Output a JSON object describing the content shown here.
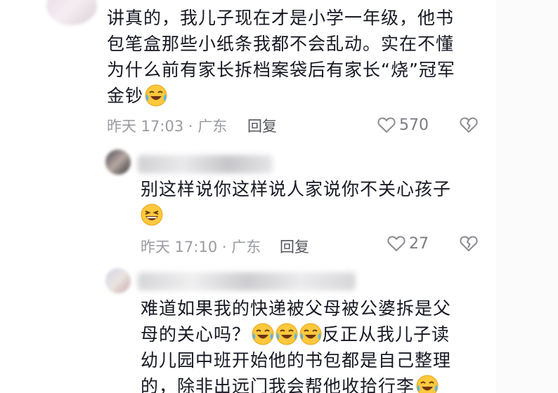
{
  "comments": [
    {
      "lines": [
        "讲真的，我儿子现在才是小学一年级，他书",
        "包笔盒那些小纸条我都不会乱动。实在不懂",
        "为什么前有家长拆档案袋后有家长“烧”冠军",
        "金钞"
      ],
      "time_location": "昨天 17:03 · 广东",
      "reply_label": "回复",
      "like_count": "570"
    },
    {
      "lines": [
        "别这样说你这样说人家说你不关心孩子"
      ],
      "time_location": "昨天 17:10 · 广东",
      "reply_label": "回复",
      "like_count": "27"
    },
    {
      "lines": [
        "难道如果我的快递被父母被公婆拆是父",
        "母的关心吗？",
        "反正从我儿子读",
        "幼儿园中班开始他的书包都是自己整理",
        "的，除非出远门我会帮他收拾行李"
      ]
    }
  ],
  "icons": {
    "like": "heart-outline-icon",
    "dislike": "broken-heart-icon",
    "laugh_cry": "laughing-crying-emoji",
    "laugh": "grinning-laugh-emoji"
  },
  "colors": {
    "text": "#161823",
    "meta": "#9a9ba1",
    "icon": "#8a8b91",
    "emoji": "#ffc83d"
  }
}
